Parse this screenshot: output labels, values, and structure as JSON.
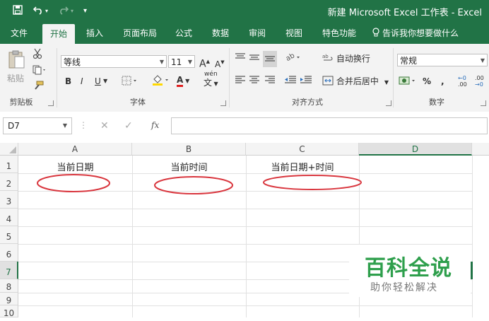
{
  "window": {
    "title": "新建 Microsoft Excel 工作表 - Excel"
  },
  "quick_access": {
    "save_icon": "save-icon",
    "undo_icon": "undo-icon",
    "redo_icon": "redo-icon",
    "customize": "▾"
  },
  "tabs": [
    {
      "label": "文件"
    },
    {
      "label": "开始"
    },
    {
      "label": "插入"
    },
    {
      "label": "页面布局"
    },
    {
      "label": "公式"
    },
    {
      "label": "数据"
    },
    {
      "label": "审阅"
    },
    {
      "label": "视图"
    },
    {
      "label": "特色功能"
    },
    {
      "label": "告诉我你想要做什么"
    }
  ],
  "ribbon": {
    "clipboard": {
      "paste": "粘贴",
      "label": "剪贴板"
    },
    "font": {
      "name": "等线",
      "size": "11",
      "grow": "A",
      "shrink": "A",
      "bold": "B",
      "italic": "I",
      "underline": "U",
      "font_color": "A",
      "wen": "wén",
      "wen_char": "文",
      "label": "字体"
    },
    "alignment": {
      "wrap": "自动换行",
      "merge": "合并后居中",
      "label": "对齐方式"
    },
    "number": {
      "format": "常规",
      "percent": "%",
      "comma": ",",
      "inc_dec": ".00",
      "dec_dec": ".00",
      "label": "数字"
    }
  },
  "formula_bar": {
    "name_box": "D7",
    "cancel": "✕",
    "enter": "✓",
    "fx": "fx",
    "value": ""
  },
  "columns": [
    "A",
    "B",
    "C",
    "D"
  ],
  "rows": [
    "1",
    "2",
    "3",
    "4",
    "5",
    "6",
    "7",
    "8",
    "9",
    "10"
  ],
  "cells": {
    "A1": "当前日期",
    "B1": "当前时间",
    "C1": "当前日期+时间"
  },
  "selected_cell": "D7",
  "watermark": {
    "title": "百科全说",
    "subtitle": "助你轻松解决"
  },
  "colors": {
    "accent": "#217346",
    "annotation": "#d9363e",
    "watermark": "#2e9f4c"
  }
}
